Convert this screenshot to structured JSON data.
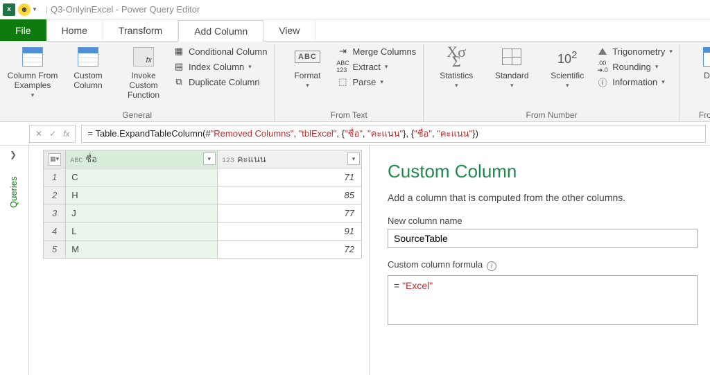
{
  "titlebar": {
    "title": "Q3-OnlyinExcel - Power Query Editor",
    "separator": "|"
  },
  "tabs": {
    "file": "File",
    "home": "Home",
    "transform": "Transform",
    "add_column": "Add Column",
    "view": "View"
  },
  "ribbon": {
    "groups": {
      "general": "General",
      "from_text": "From Text",
      "from_number": "From Number",
      "from_date": "From D"
    },
    "column_from_examples": "Column From\nExamples",
    "custom_column": "Custom\nColumn",
    "invoke_custom_function": "Invoke Custom\nFunction",
    "conditional_column": "Conditional Column",
    "index_column": "Index Column",
    "duplicate_column": "Duplicate Column",
    "format": "Format",
    "merge_columns": "Merge Columns",
    "extract": "Extract",
    "parse": "Parse",
    "statistics": "Statistics",
    "standard": "Standard",
    "scientific": "Scientific",
    "trigonometry": "Trigonometry",
    "rounding": "Rounding",
    "information": "Information",
    "date": "Date"
  },
  "formula_bar": {
    "prefix": "= ",
    "fn": "Table.ExpandTableColumn",
    "open": "(#",
    "arg1": "\"Removed Columns\"",
    "c1": ", ",
    "arg2": "\"tblExcel\"",
    "c2": ", {",
    "arg3a": "\"ชื่อ\"",
    "c3": ", ",
    "arg3b": "\"คะแนน\"",
    "c4": "}, {",
    "arg4a": "\"ชื่อ\"",
    "c5": ", ",
    "arg4b": "\"คะแนน\"",
    "close": "})"
  },
  "queries_rail": "Queries",
  "grid": {
    "col1_type": "ABC",
    "col1": "ชื่อ",
    "col2_type": "123",
    "col2": "คะแนน",
    "rows": [
      {
        "n": "1",
        "name": "C",
        "score": "71"
      },
      {
        "n": "2",
        "name": "H",
        "score": "85"
      },
      {
        "n": "3",
        "name": "J",
        "score": "77"
      },
      {
        "n": "4",
        "name": "L",
        "score": "91"
      },
      {
        "n": "5",
        "name": "M",
        "score": "72"
      }
    ]
  },
  "panel": {
    "heading": "Custom Column",
    "desc": "Add a column that is computed from the other columns.",
    "name_label": "New column name",
    "name_value": "SourceTable",
    "formula_label": "Custom column formula",
    "formula_prefix": "= ",
    "formula_value": "\"Excel\""
  }
}
